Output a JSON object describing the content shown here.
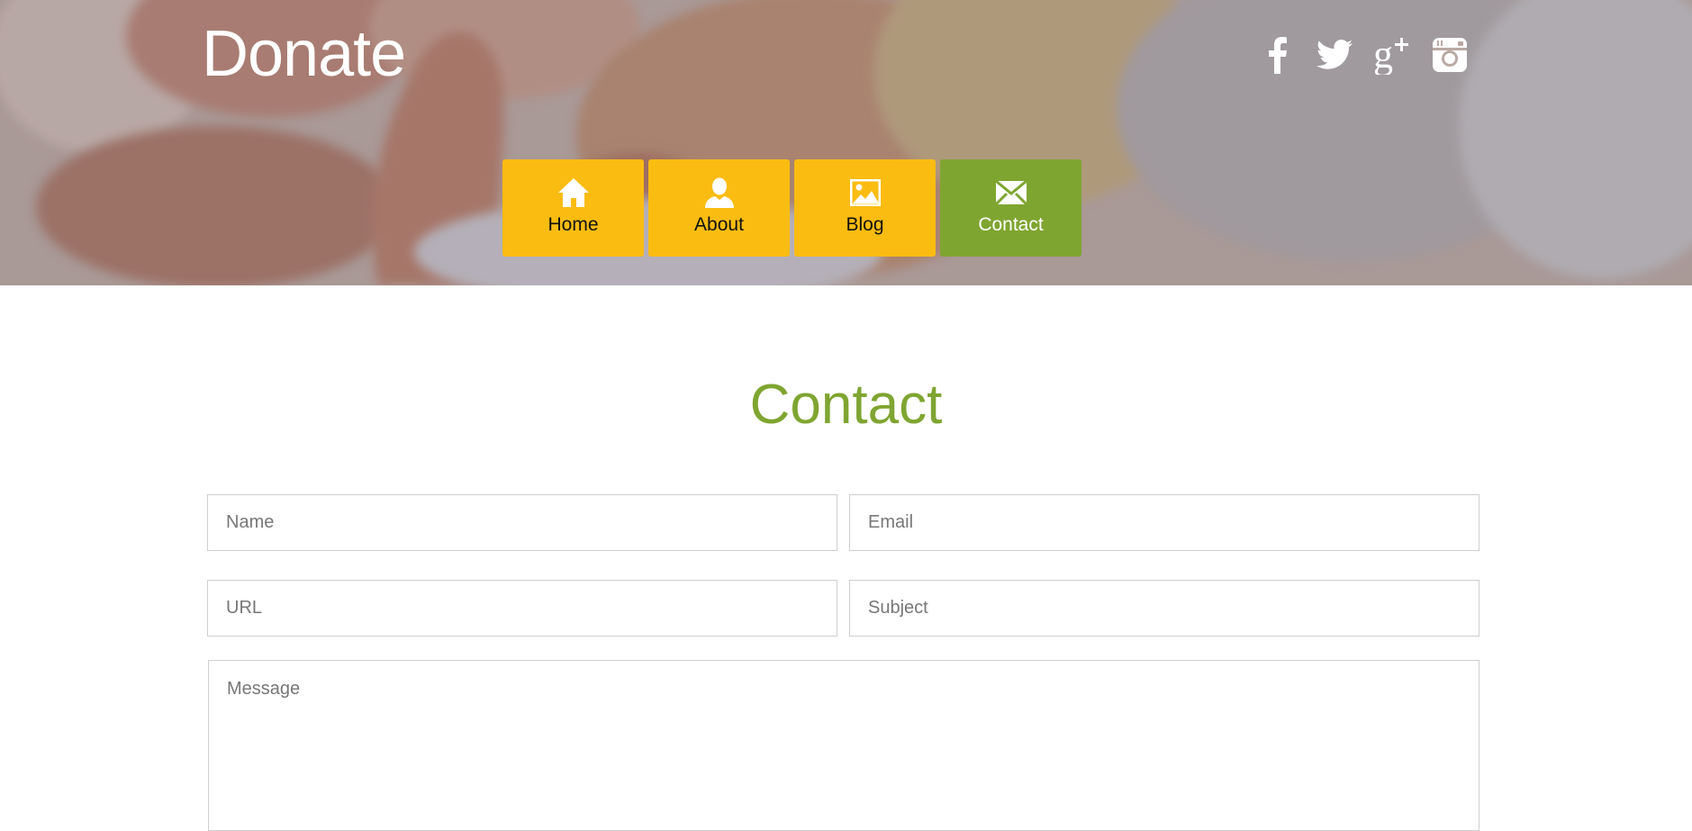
{
  "site": {
    "brand": "Donate"
  },
  "colors": {
    "nav_default": "#fbbc12",
    "nav_active": "#7fa531",
    "title_green": "#7fa531"
  },
  "social": [
    {
      "name": "facebook",
      "icon": "facebook-icon"
    },
    {
      "name": "twitter",
      "icon": "twitter-icon"
    },
    {
      "name": "google-plus",
      "icon": "google-plus-icon"
    },
    {
      "name": "instagram",
      "icon": "instagram-icon"
    }
  ],
  "nav": {
    "items": [
      {
        "label": "Home",
        "icon": "home-icon",
        "active": false
      },
      {
        "label": "About",
        "icon": "user-icon",
        "active": false
      },
      {
        "label": "Blog",
        "icon": "image-icon",
        "active": false
      },
      {
        "label": "Contact",
        "icon": "envelope-icon",
        "active": true
      }
    ]
  },
  "contact": {
    "title": "Contact",
    "name_placeholder": "Name",
    "email_placeholder": "Email",
    "url_placeholder": "URL",
    "subject_placeholder": "Subject",
    "message_placeholder": "Message"
  }
}
